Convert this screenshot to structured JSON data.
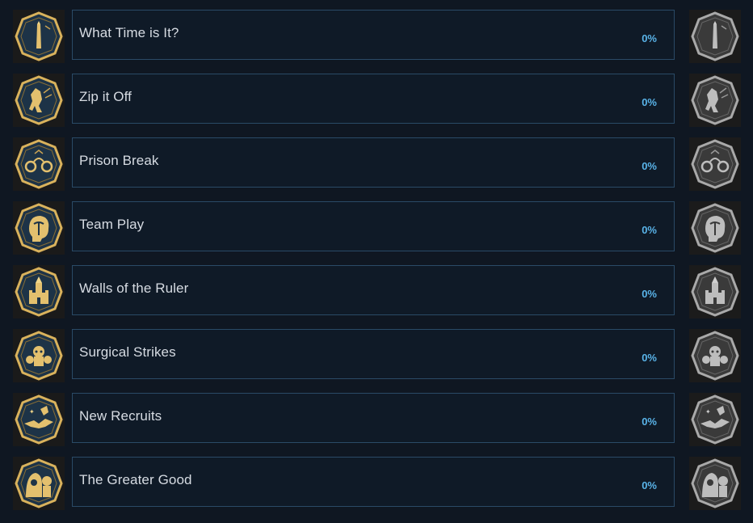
{
  "achievements": [
    {
      "name": "What Time is It?",
      "percent": "0%",
      "icon": "obelisk-icon"
    },
    {
      "name": "Zip it Off",
      "percent": "0%",
      "icon": "leaping-assassin-icon"
    },
    {
      "name": "Prison Break",
      "percent": "0%",
      "icon": "shackles-icon"
    },
    {
      "name": "Team Play",
      "percent": "0%",
      "icon": "head-palm-icon"
    },
    {
      "name": "Walls of the Ruler",
      "percent": "0%",
      "icon": "castle-icon"
    },
    {
      "name": "Surgical Strikes",
      "percent": "0%",
      "icon": "skulls-icon"
    },
    {
      "name": "New Recruits",
      "percent": "0%",
      "icon": "handshake-icon"
    },
    {
      "name": "The Greater Good",
      "percent": "0%",
      "icon": "hooded-figures-icon"
    }
  ],
  "colors": {
    "background": "#0f1722",
    "panel_border": "#2a4a66",
    "name_text": "#d6dbe2",
    "percent_text": "#59b3e8",
    "unlocked_gold": "#d9b25c",
    "locked_gray": "#a9a9a9"
  }
}
